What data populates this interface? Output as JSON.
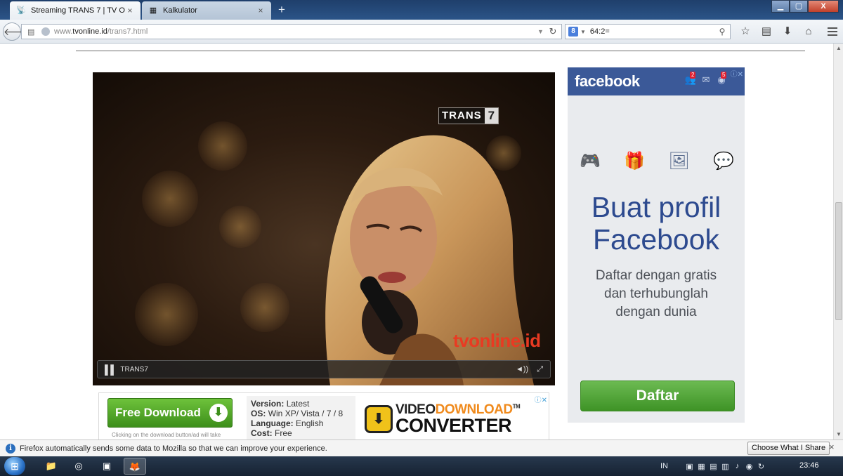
{
  "browser": {
    "tabs": [
      {
        "title": "Streaming TRANS 7 | TV O...",
        "close": "×",
        "active": true
      },
      {
        "title": "Kalkulator",
        "close": "×",
        "active": false
      }
    ],
    "new_tab": "+",
    "window_buttons": {
      "minimize": "▁",
      "maximize": "▢",
      "close": "X"
    },
    "address": {
      "prefix": "www.",
      "domain": "tvonline.id",
      "path": "/trans7.html"
    },
    "search": {
      "value": "64:2="
    }
  },
  "video": {
    "channel_logo": {
      "left": "TRANS",
      "right": "7"
    },
    "watermark": "tvonline.id",
    "control_label": "TRANS7"
  },
  "download_ad": {
    "button_label": "Free Download",
    "note": "Clicking on the download button/ad will take",
    "info": {
      "version_label": "Version:",
      "version": "Latest",
      "os_label": "OS:",
      "os": "Win XP/ Vista / 7 / 8",
      "language_label": "Language:",
      "language": "English",
      "cost_label": "Cost:",
      "cost": "Free"
    },
    "brand_line1_a": "VIDEO",
    "brand_line1_b": "DOWNLOAD",
    "brand_tm": "TM",
    "brand_line2": "CONVERTER"
  },
  "facebook_ad": {
    "logo": "facebook",
    "friend_badge": "2",
    "globe_badge": "5",
    "headline_line1": "Buat profil",
    "headline_line2": "Facebook",
    "sub_line1": "Daftar dengan gratis",
    "sub_line2": "dan terhubunglah",
    "sub_line3": "dengan dunia",
    "button": "Daftar"
  },
  "notification": {
    "message": "Firefox automatically sends some data to Mozilla so that we can improve your experience.",
    "button": "Choose What I Share",
    "close": "×"
  },
  "taskbar": {
    "language": "IN",
    "clock": "23:46"
  },
  "colors": {
    "facebook_blue": "#3b5998",
    "facebook_green": "#4ca535",
    "download_green": "#4fa526",
    "watermark_red": "#e93a22"
  }
}
